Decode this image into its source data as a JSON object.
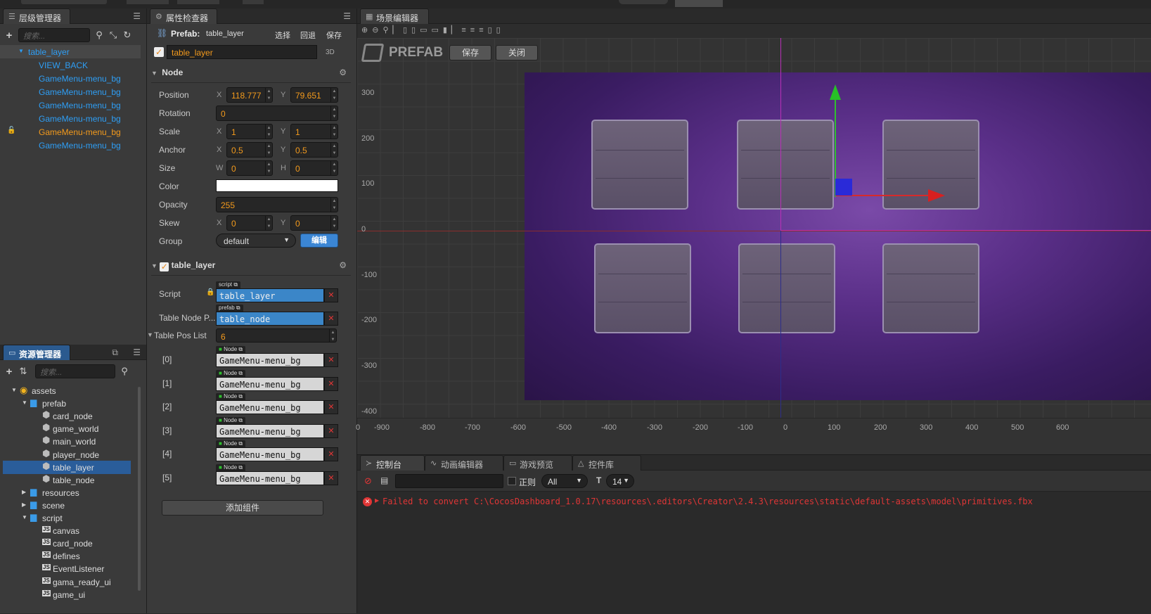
{
  "hierarchy": {
    "title": "层级管理器",
    "search_placeholder": "搜索...",
    "nodes": [
      {
        "label": "table_layer",
        "color": "blue",
        "selected": true
      },
      {
        "label": "VIEW_BACK",
        "color": "blue"
      },
      {
        "label": "GameMenu-menu_bg",
        "color": "blue"
      },
      {
        "label": "GameMenu-menu_bg",
        "color": "blue"
      },
      {
        "label": "GameMenu-menu_bg",
        "color": "blue"
      },
      {
        "label": "GameMenu-menu_bg",
        "color": "blue"
      },
      {
        "label": "GameMenu-menu_bg",
        "color": "orange",
        "locked": true
      },
      {
        "label": "GameMenu-menu_bg",
        "color": "blue"
      }
    ]
  },
  "assets": {
    "title": "资源管理器",
    "search_placeholder": "搜索...",
    "items": [
      {
        "label": "assets",
        "depth": 0,
        "type": "root",
        "open": true
      },
      {
        "label": "prefab",
        "depth": 1,
        "type": "folder",
        "open": true
      },
      {
        "label": "card_node",
        "depth": 2,
        "type": "prefab"
      },
      {
        "label": "game_world",
        "depth": 2,
        "type": "prefab"
      },
      {
        "label": "main_world",
        "depth": 2,
        "type": "prefab"
      },
      {
        "label": "player_node",
        "depth": 2,
        "type": "prefab"
      },
      {
        "label": "table_layer",
        "depth": 2,
        "type": "prefab",
        "selected": true
      },
      {
        "label": "table_node",
        "depth": 2,
        "type": "prefab"
      },
      {
        "label": "resources",
        "depth": 1,
        "type": "folder",
        "open": false
      },
      {
        "label": "scene",
        "depth": 1,
        "type": "folder",
        "open": false
      },
      {
        "label": "script",
        "depth": 1,
        "type": "folder",
        "open": true
      },
      {
        "label": "canvas",
        "depth": 2,
        "type": "js"
      },
      {
        "label": "card_node",
        "depth": 2,
        "type": "js"
      },
      {
        "label": "defines",
        "depth": 2,
        "type": "js"
      },
      {
        "label": "EventListener",
        "depth": 2,
        "type": "js"
      },
      {
        "label": "gama_ready_ui",
        "depth": 2,
        "type": "js"
      },
      {
        "label": "game_ui",
        "depth": 2,
        "type": "js"
      }
    ]
  },
  "inspector": {
    "title": "属性检查器",
    "prefab_label": "Prefab:",
    "prefab_name": "table_layer",
    "select": "选择",
    "revert": "回退",
    "save": "保存",
    "node_name": "table_layer",
    "mode_3d": "3D",
    "node_section": "Node",
    "labels": {
      "position": "Position",
      "rotation": "Rotation",
      "scale": "Scale",
      "anchor": "Anchor",
      "size": "Size",
      "color": "Color",
      "opacity": "Opacity",
      "skew": "Skew",
      "group": "Group"
    },
    "axes": {
      "x": "X",
      "y": "Y",
      "w": "W",
      "h": "H"
    },
    "position": {
      "x": "118.777",
      "y": "79.651"
    },
    "rotation": "0",
    "scale": {
      "x": "1",
      "y": "1"
    },
    "anchor": {
      "x": "0.5",
      "y": "0.5"
    },
    "size": {
      "w": "0",
      "h": "0"
    },
    "color": "#ffffff",
    "opacity": "255",
    "skew": {
      "x": "0",
      "y": "0"
    },
    "group": "default",
    "edit": "编辑",
    "component_name": "table_layer",
    "script_label": "Script",
    "script_tag": "script",
    "script_value": "table_layer",
    "table_node_label": "Table Node P...",
    "prefab_tag": "prefab",
    "table_node_value": "table_node",
    "pos_list_label": "Table Pos List",
    "pos_list_count": "6",
    "node_tag": "Node",
    "pos_list": [
      {
        "index": "[0]",
        "value": "GameMenu-menu_bg"
      },
      {
        "index": "[1]",
        "value": "GameMenu-menu_bg"
      },
      {
        "index": "[2]",
        "value": "GameMenu-menu_bg"
      },
      {
        "index": "[3]",
        "value": "GameMenu-menu_bg"
      },
      {
        "index": "[4]",
        "value": "GameMenu-menu_bg"
      },
      {
        "index": "[5]",
        "value": "GameMenu-menu_bg"
      }
    ],
    "add_component": "添加组件"
  },
  "scene": {
    "title": "场景编辑器",
    "prefab_mark": "PREFAB",
    "save": "保存",
    "close": "关闭",
    "y_ticks": [
      "300",
      "200",
      "100",
      "0",
      "-100",
      "-200",
      "-300",
      "-400"
    ],
    "x_ticks": [
      "0",
      "-900",
      "-800",
      "-700",
      "-600",
      "-500",
      "-400",
      "-300",
      "-200",
      "-100",
      "0",
      "100",
      "200",
      "300",
      "400",
      "500",
      "600"
    ]
  },
  "console": {
    "tabs": [
      "控制台",
      "动画编辑器",
      "游戏预览",
      "控件库"
    ],
    "regex": "正则",
    "level": "All",
    "font_size": "14",
    "error": "Failed to convert C:\\CocosDashboard_1.0.17\\resources\\.editors\\Creator\\2.4.3\\resources\\static\\default-assets\\model\\primitives.fbx"
  },
  "colors": {
    "accent": "#2e9ef5",
    "warning": "#f39a1c",
    "error": "#e03636",
    "selection": "#2a5d9a"
  }
}
